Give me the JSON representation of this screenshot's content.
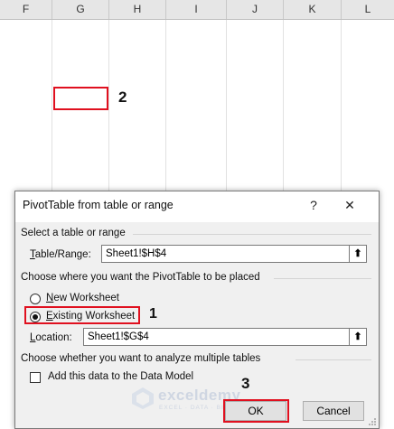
{
  "sheet": {
    "columns": [
      "F",
      "G",
      "H",
      "I",
      "J",
      "K",
      "L"
    ],
    "step_labels": {
      "cell_marker": "2",
      "radio_marker": "1",
      "ok_marker": "3"
    }
  },
  "dialog": {
    "title": "PivotTable from table or range",
    "help_glyph": "?",
    "close_glyph": "✕",
    "section_select": "Select a table or range",
    "table_range": {
      "label_prefix": "",
      "label_underline": "T",
      "label_rest": "able/Range:",
      "value": "Sheet1!$H$4"
    },
    "section_place": "Choose where you want the PivotTable to be placed",
    "new_worksheet": {
      "underline": "N",
      "rest": "ew Worksheet",
      "selected": false
    },
    "existing_worksheet": {
      "underline": "E",
      "rest": "xisting Worksheet",
      "selected": true
    },
    "location": {
      "label_underline": "L",
      "label_rest": "ocation:",
      "value": "Sheet1!$G$4"
    },
    "section_multi": "Choose whether you want to analyze multiple tables",
    "data_model": {
      "label": "Add this data to the Data Model",
      "checked": false
    },
    "ok_label": "OK",
    "cancel_label": "Cancel",
    "ref_button_glyph": "⬆"
  },
  "watermark": {
    "name": "exceldemy",
    "tag": "EXCEL · DATA · BI"
  },
  "colors": {
    "highlight": "#e0101f",
    "dialog_body": "#f0f0f0",
    "header_bg": "#e6e6e6"
  }
}
